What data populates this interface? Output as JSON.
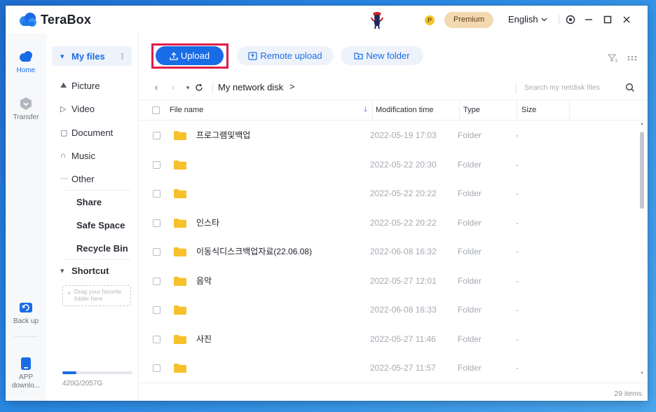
{
  "app": {
    "name": "TeraBox",
    "premium_label": "Premium",
    "premium_badge": "P",
    "language": "English"
  },
  "rail": {
    "items": [
      {
        "label": "Home",
        "icon": "cloud-icon"
      },
      {
        "label": "Transfer",
        "icon": "shield-transfer-icon"
      },
      {
        "label": "Back up",
        "icon": "backup-icon"
      },
      {
        "label": "APP downlo...",
        "icon": "phone-icon"
      }
    ]
  },
  "nav": {
    "my_files": "My files",
    "items": [
      {
        "label": "Picture",
        "glyph": "⛰"
      },
      {
        "label": "Video",
        "glyph": "▷"
      },
      {
        "label": "Document",
        "glyph": "▢"
      },
      {
        "label": "Music",
        "glyph": "∩"
      },
      {
        "label": "Other",
        "glyph": "···"
      }
    ],
    "share": "Share",
    "safe_space": "Safe Space",
    "recycle_bin": "Recycle Bin",
    "shortcut": "Shortcut",
    "drop_hint": "Drag your favorite folder here",
    "storage_text": "420G/2057G",
    "storage_fraction": 0.2
  },
  "toolbar": {
    "upload": "Upload",
    "remote_upload": "Remote upload",
    "new_folder": "New folder"
  },
  "pathbar": {
    "title": "My network disk",
    "arrow": ">",
    "search_placeholder": "Search my netdisk files"
  },
  "table": {
    "headers": {
      "name": "File name",
      "modified": "Modification time",
      "type": "Type",
      "size": "Size"
    },
    "rows": [
      {
        "name": "프로그램및백업",
        "time": "2022-05-19 17:03",
        "type": "Folder",
        "size": "-"
      },
      {
        "name": "",
        "time": "2022-05-22 20:30",
        "type": "Folder",
        "size": "-"
      },
      {
        "name": "",
        "time": "2022-05-22 20:22",
        "type": "Folder",
        "size": "-"
      },
      {
        "name": "인스타",
        "time": "2022-05-22 20:22",
        "type": "Folder",
        "size": "-"
      },
      {
        "name": "이동식디스크백업자료(22.06.08)",
        "time": "2022-06-08 16:32",
        "type": "Folder",
        "size": "-"
      },
      {
        "name": "음악",
        "time": "2022-05-27 12:01",
        "type": "Folder",
        "size": "-"
      },
      {
        "name": "",
        "time": "2022-06-08 16:33",
        "type": "Folder",
        "size": "-"
      },
      {
        "name": "사진",
        "time": "2022-05-27 11:46",
        "type": "Folder",
        "size": "-"
      },
      {
        "name": "",
        "time": "2022-05-27 11:57",
        "type": "Folder",
        "size": "-"
      }
    ],
    "items_count": "29 items"
  },
  "colors": {
    "accent": "#1a6ce6",
    "highlight_box": "#e11d4a",
    "folder": "#f7c12c",
    "premium_bg": "#f3d9b0"
  }
}
